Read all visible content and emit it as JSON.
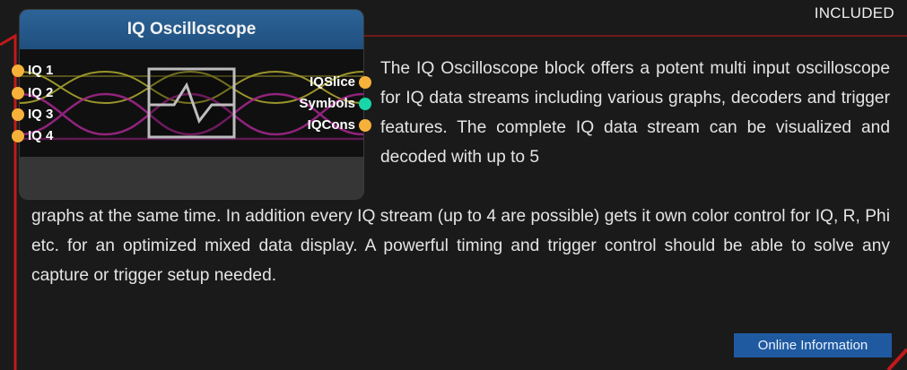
{
  "badge": "INCLUDED",
  "block": {
    "title": "IQ Oscilloscope",
    "inputs": [
      {
        "label": "IQ 1",
        "color": "#f6b13a"
      },
      {
        "label": "IQ 2",
        "color": "#f6b13a"
      },
      {
        "label": "IQ 3",
        "color": "#f6b13a"
      },
      {
        "label": "IQ 4",
        "color": "#f6b13a"
      }
    ],
    "outputs": [
      {
        "label": "IQSlice",
        "color": "#f6b13a"
      },
      {
        "label": "Symbols",
        "color": "#19d6a8"
      },
      {
        "label": "IQCons",
        "color": "#f6b13a"
      }
    ],
    "icon": "oscilloscope-icon"
  },
  "description": {
    "part1": "The IQ Oscilloscope block offers a potent multi input oscilloscope for IQ data streams including various graphs, decoders and trigger features. The complete IQ data stream can be visualized and decoded with up to 5",
    "part2": "graphs at the same time. In addition every IQ stream (up to 4 are possible) gets it own color control for IQ, R, Phi etc. for an optimized mixed data display. A powerful timing and trigger control should be able to solve any capture or trigger setup needed."
  },
  "online_button": "Online Information",
  "colors": {
    "frame": "#c21a1a",
    "accent": "#1f5aa0"
  }
}
